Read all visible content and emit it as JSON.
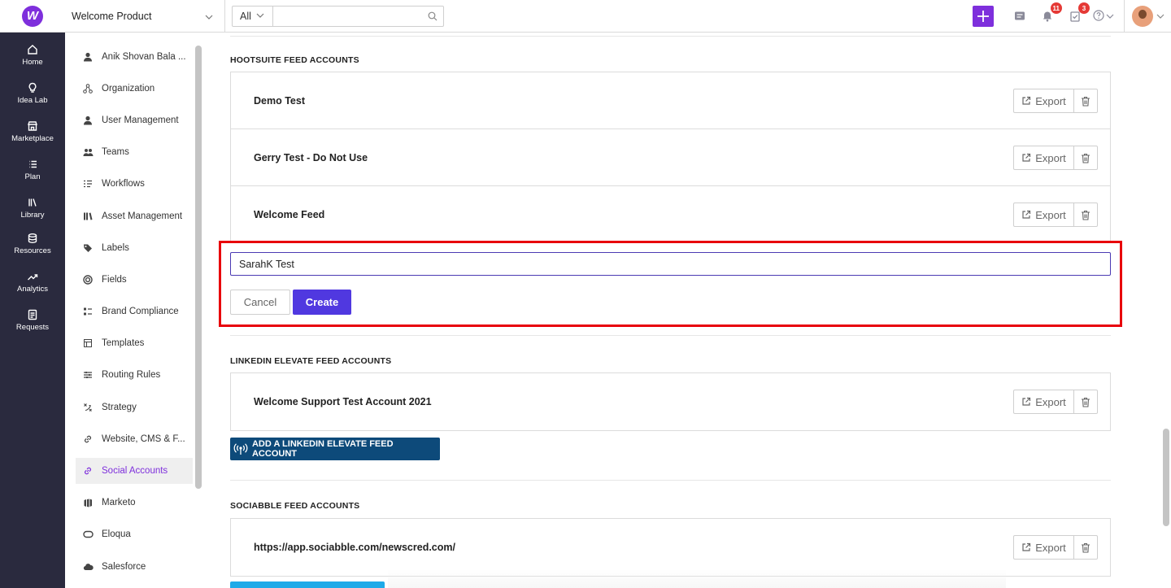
{
  "topbar": {
    "logo_letter": "W",
    "product": "Welcome Product",
    "search_scope": "All",
    "search_placeholder": "",
    "notifications_count": "11",
    "tasks_count": "3"
  },
  "leftnav": [
    {
      "label": "Home",
      "icon": "home-icon"
    },
    {
      "label": "Idea Lab",
      "icon": "lightbulb-icon"
    },
    {
      "label": "Marketplace",
      "icon": "store-icon"
    },
    {
      "label": "Plan",
      "icon": "list-icon"
    },
    {
      "label": "Library",
      "icon": "library-icon"
    },
    {
      "label": "Resources",
      "icon": "database-icon"
    },
    {
      "label": "Analytics",
      "icon": "trend-icon"
    },
    {
      "label": "Requests",
      "icon": "document-icon"
    }
  ],
  "settings": [
    {
      "label": "Anik Shovan Bala ...",
      "icon": "person-icon"
    },
    {
      "label": "Organization",
      "icon": "org-icon"
    },
    {
      "label": "User Management",
      "icon": "person-icon"
    },
    {
      "label": "Teams",
      "icon": "team-icon"
    },
    {
      "label": "Workflows",
      "icon": "workflow-icon"
    },
    {
      "label": "Asset Management",
      "icon": "books-icon"
    },
    {
      "label": "Labels",
      "icon": "tag-icon"
    },
    {
      "label": "Fields",
      "icon": "target-icon"
    },
    {
      "label": "Brand Compliance",
      "icon": "checklist-icon"
    },
    {
      "label": "Templates",
      "icon": "template-icon"
    },
    {
      "label": "Routing Rules",
      "icon": "routing-icon"
    },
    {
      "label": "Strategy",
      "icon": "strategy-icon"
    },
    {
      "label": "Website, CMS & F...",
      "icon": "link-icon"
    },
    {
      "label": "Social Accounts",
      "icon": "link-icon",
      "active": true
    },
    {
      "label": "Marketo",
      "icon": "marketo-icon"
    },
    {
      "label": "Eloqua",
      "icon": "eloqua-icon"
    },
    {
      "label": "Salesforce",
      "icon": "cloud-icon"
    }
  ],
  "hootsuite": {
    "title": "HOOTSUITE FEED ACCOUNTS",
    "rows": [
      "Demo Test",
      "Gerry Test - Do Not Use",
      "Welcome Feed"
    ],
    "new_value": "SarahK Test",
    "cancel_label": "Cancel",
    "create_label": "Create"
  },
  "linkedin": {
    "title": "LINKEDIN ELEVATE FEED ACCOUNTS",
    "rows": [
      "Welcome Support Test Account 2021"
    ],
    "add_label": "ADD A LINKEDIN ELEVATE FEED ACCOUNT"
  },
  "sociabble": {
    "title": "SOCIABBLE FEED ACCOUNTS",
    "rows": [
      "https://app.sociabble.com/newscred.com/"
    ]
  },
  "export_label": "Export",
  "colors": {
    "brand": "#7e2fdc",
    "create": "#5038e0",
    "highlight": "#e8000b",
    "nav_bg": "#2a2a3e",
    "linkedin_btn": "#0d4a7a"
  }
}
